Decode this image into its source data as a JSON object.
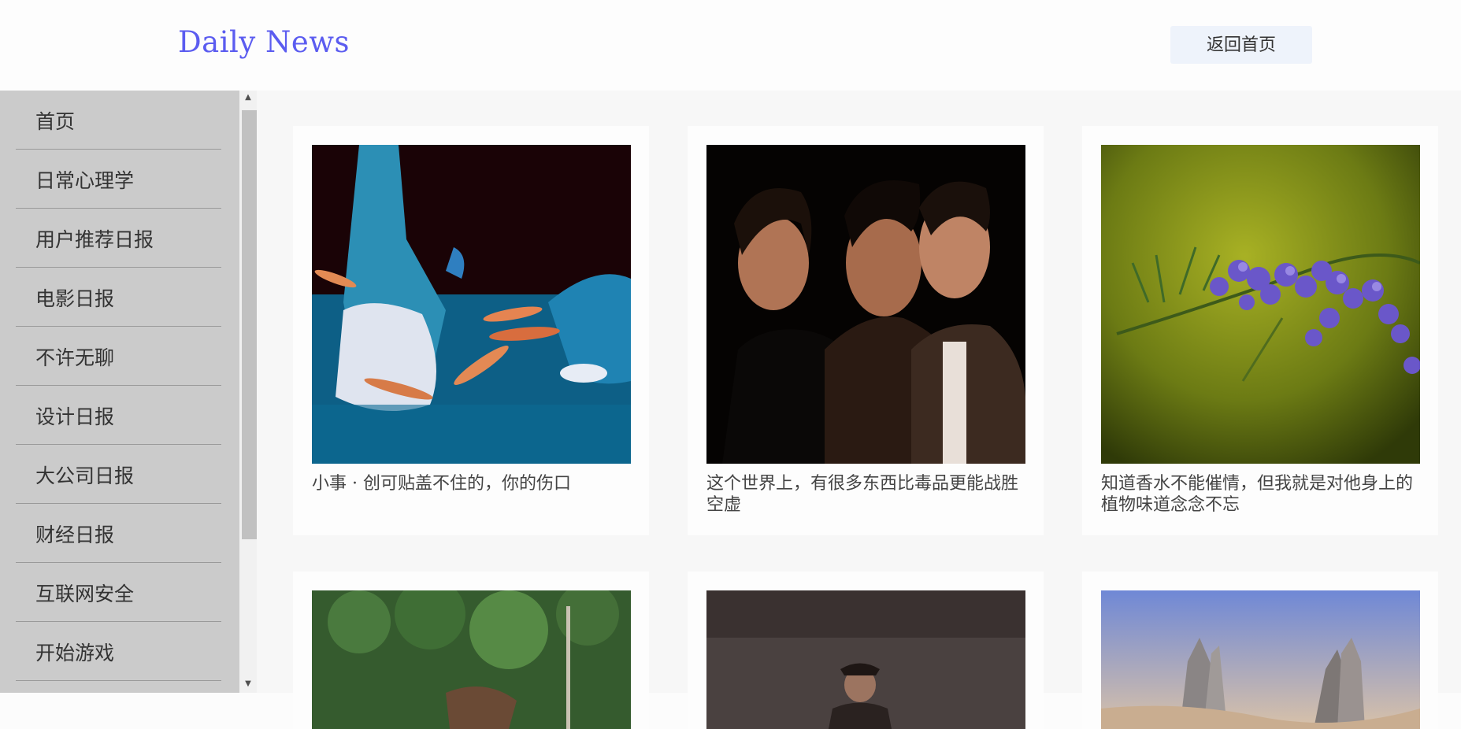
{
  "header": {
    "logo": "Daily News",
    "back_label": "返回首页"
  },
  "sidebar": {
    "items": [
      {
        "label": "首页"
      },
      {
        "label": "日常心理学"
      },
      {
        "label": "用户推荐日报"
      },
      {
        "label": "电影日报"
      },
      {
        "label": "不许无聊"
      },
      {
        "label": "设计日报"
      },
      {
        "label": "大公司日报"
      },
      {
        "label": "财经日报"
      },
      {
        "label": "互联网安全"
      },
      {
        "label": "开始游戏"
      }
    ]
  },
  "stories": [
    {
      "title": "小事 · 创可贴盖不住的，你的伤口",
      "image": "feet-with-fish-photo"
    },
    {
      "title": "这个世界上，有很多东西比毒品更能战胜空虚",
      "image": "three-actors-movie-photo"
    },
    {
      "title": "知道香水不能催情，但我就是对他身上的植物味道念念不忘",
      "image": "purple-rosemary-flower-photo"
    },
    {
      "title": "",
      "image": "forest-photo"
    },
    {
      "title": "",
      "image": "person-with-cap-photo"
    },
    {
      "title": "",
      "image": "rock-formations-photo"
    }
  ],
  "colors": {
    "logo": "#5b5cf0",
    "sidebar": "#cbcbcb",
    "back_button": "#eef3fb"
  }
}
